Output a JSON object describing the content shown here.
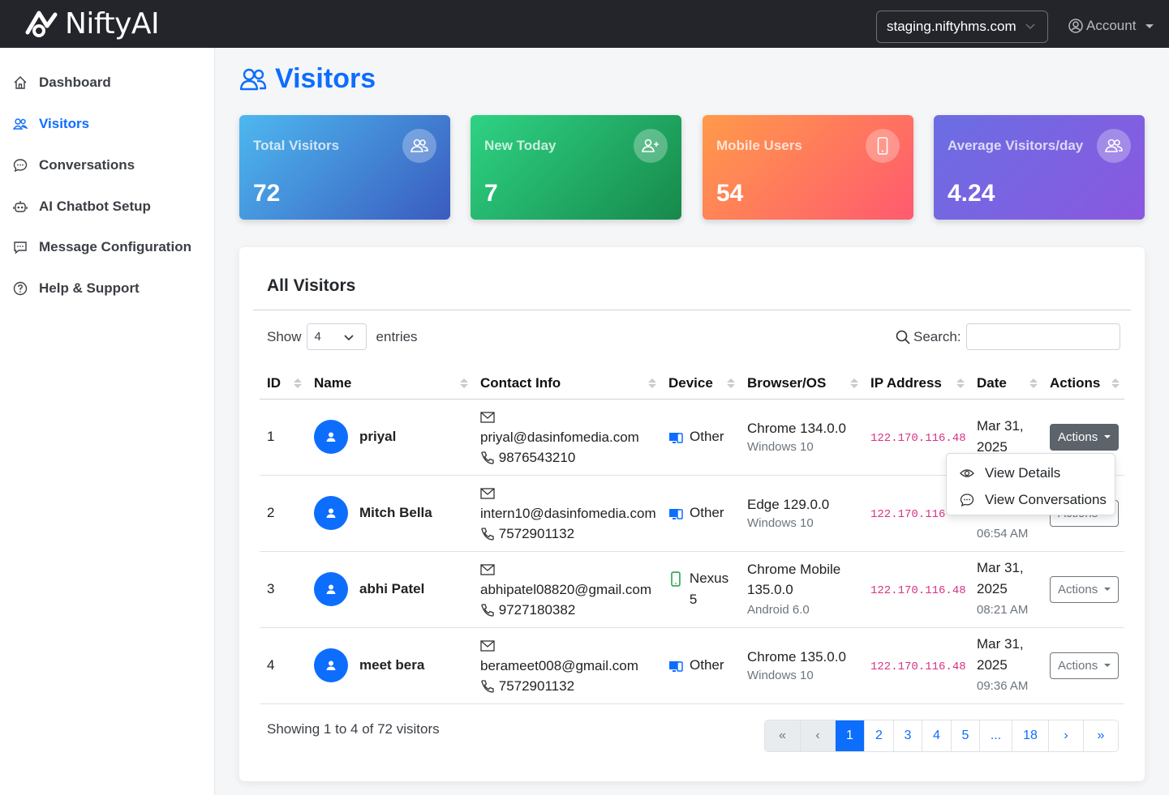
{
  "app": {
    "logo_text": "NiftyAI"
  },
  "header": {
    "domain": "staging.niftyhms.com",
    "account_label": "Account"
  },
  "sidebar": {
    "items": [
      {
        "label": "Dashboard",
        "icon": "home-icon"
      },
      {
        "label": "Visitors",
        "icon": "users-icon"
      },
      {
        "label": "Conversations",
        "icon": "chat-icon"
      },
      {
        "label": "AI Chatbot Setup",
        "icon": "robot-icon"
      },
      {
        "label": "Message Configuration",
        "icon": "message-dots-icon"
      },
      {
        "label": "Help & Support",
        "icon": "question-circle-icon"
      }
    ],
    "active": "Visitors"
  },
  "page": {
    "title": "Visitors"
  },
  "stats": [
    {
      "label": "Total Visitors",
      "value": "72",
      "icon": "users-icon"
    },
    {
      "label": "New Today",
      "value": "7",
      "icon": "user-plus-icon"
    },
    {
      "label": "Mobile Users",
      "value": "54",
      "icon": "phone-icon"
    },
    {
      "label": "Average Visitors/day",
      "value": "4.24",
      "icon": "users-icon"
    }
  ],
  "table": {
    "title": "All Visitors",
    "show_label": "Show",
    "show_value": "4",
    "entries_label": "entries",
    "search_label": "Search:",
    "search_value": "",
    "columns": [
      "ID",
      "Name",
      "Contact Info",
      "Device",
      "Browser/OS",
      "IP Address",
      "Date",
      "Actions"
    ],
    "rows": [
      {
        "id": "1",
        "name": "priyal",
        "email": "priyal@dasinfomedia.com",
        "phone": "9876543210",
        "device": "Other",
        "device_type": "desktop",
        "browser": "Chrome 134.0.0",
        "os": "Windows 10",
        "ip": "122.170.116.48",
        "date": "Mar 31, 2025",
        "time": "",
        "action": "Actions"
      },
      {
        "id": "2",
        "name": "Mitch Bella",
        "email": "intern10@dasinfomedia.com",
        "phone": "7572901132",
        "device": "Other",
        "device_type": "desktop",
        "browser": "Edge 129.0.0",
        "os": "Windows 10",
        "ip": "122.170.116",
        "date": "",
        "time": "06:54 AM",
        "action": "Actions"
      },
      {
        "id": "3",
        "name": "abhi Patel",
        "email": "abhipatel08820@gmail.com",
        "phone": "9727180382",
        "device": "Nexus 5",
        "device_type": "mobile",
        "browser": "Chrome Mobile 135.0.0",
        "os": "Android 6.0",
        "ip": "122.170.116.48",
        "date": "Mar 31, 2025",
        "time": "08:21 AM",
        "action": "Actions"
      },
      {
        "id": "4",
        "name": "meet bera",
        "email": "berameet008@gmail.com",
        "phone": "7572901132",
        "device": "Other",
        "device_type": "desktop",
        "browser": "Chrome 135.0.0",
        "os": "Windows 10",
        "ip": "122.170.116.48",
        "date": "Mar 31, 2025",
        "time": "09:36 AM",
        "action": "Actions"
      }
    ],
    "dropdown": {
      "items": [
        "View Details",
        "View Conversations"
      ]
    },
    "showing_text": "Showing 1 to 4 of 72 visitors",
    "pagination": [
      "«",
      "‹",
      "1",
      "2",
      "3",
      "4",
      "5",
      "...",
      "18",
      "›",
      "»"
    ],
    "current_page": "1"
  },
  "colors": {
    "primary": "#0d6efd",
    "topbar": "#23252b",
    "ip": "#d63384"
  }
}
